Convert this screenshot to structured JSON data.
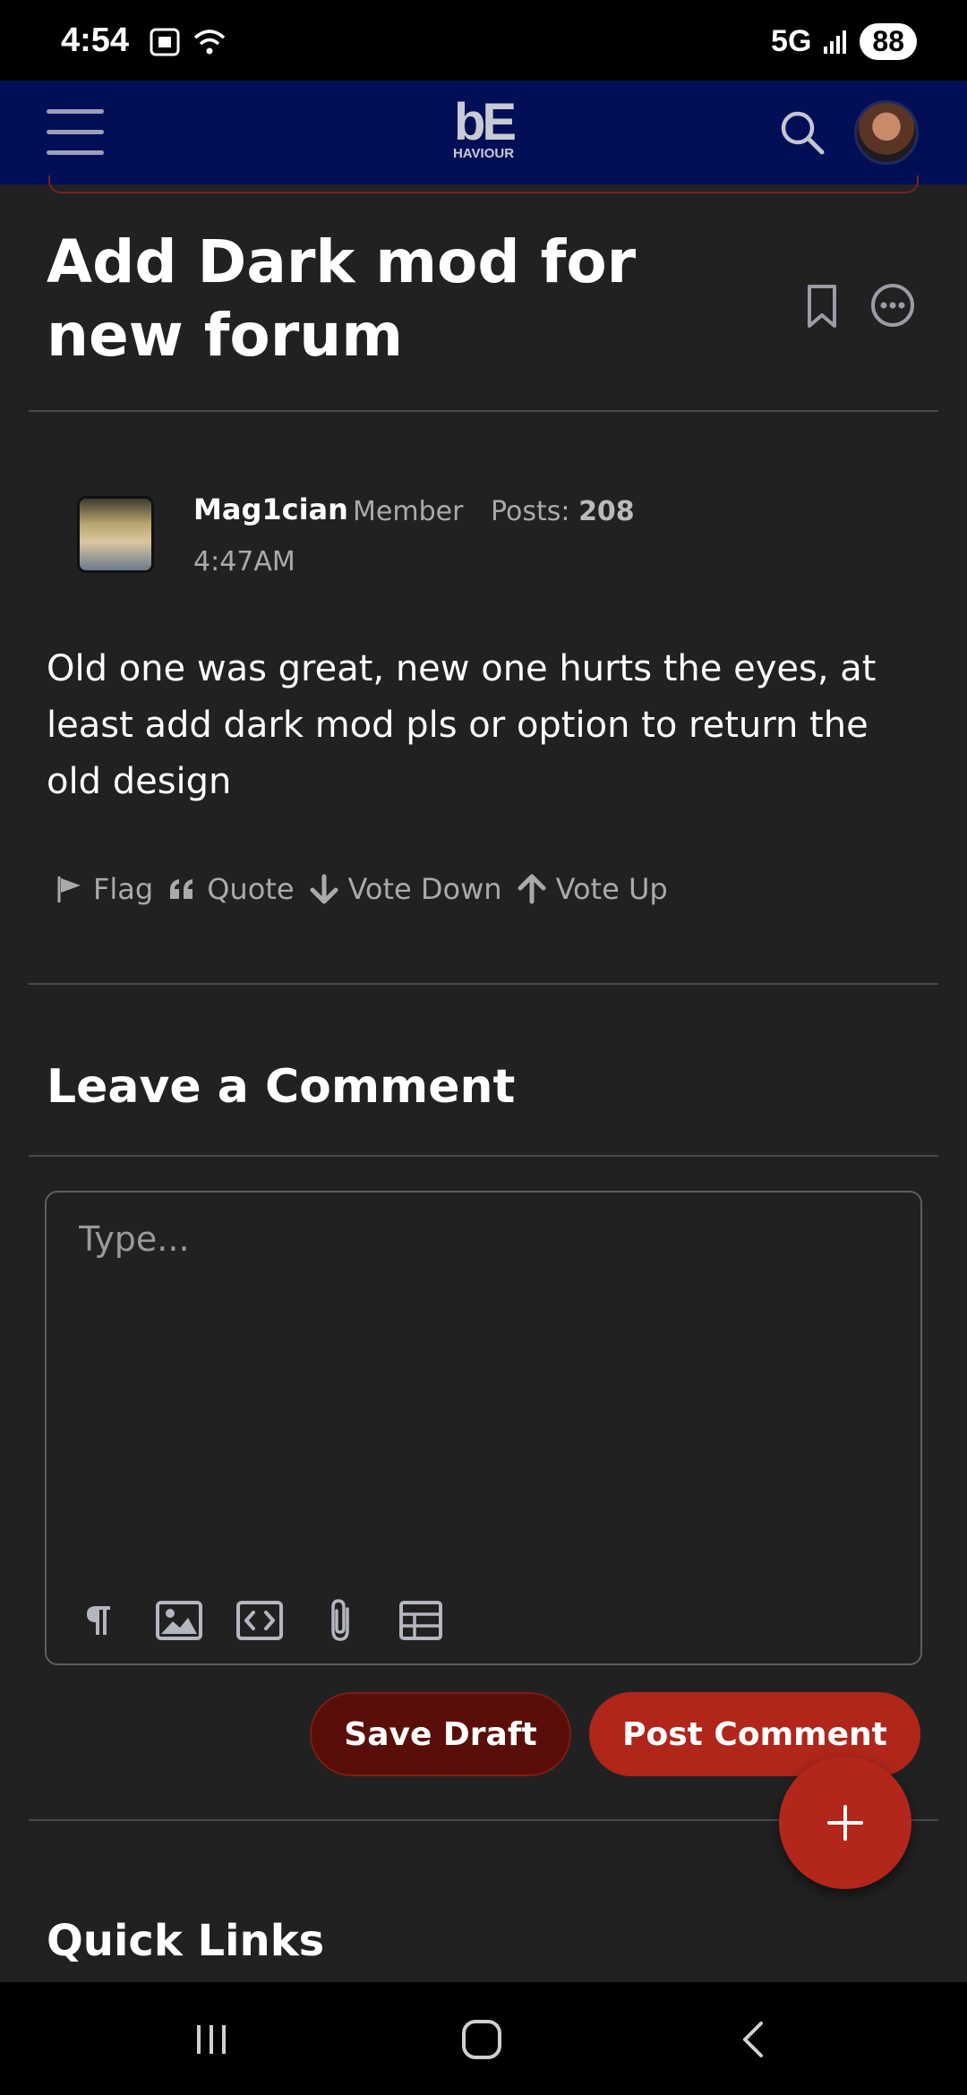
{
  "status_bar": {
    "time": "4:54",
    "network": "5G",
    "battery": "88"
  },
  "header": {
    "logo_main": "bE",
    "logo_sub": "HAVIOUR"
  },
  "post": {
    "title": "Add Dark mod for new forum",
    "author": {
      "name": "Mag1cian",
      "role": "Member",
      "posts_label": "Posts:",
      "posts_count": "208",
      "time": "4:47AM"
    },
    "body": "Old one was great, new one hurts the eyes, at least add dark mod pls or option to return the old design",
    "actions": {
      "flag": "Flag",
      "quote": "Quote",
      "vote_down": "Vote Down",
      "vote_up": "Vote Up"
    }
  },
  "comment": {
    "heading": "Leave a Comment",
    "placeholder": "Type...",
    "save_label": "Save Draft",
    "post_label": "Post Comment"
  },
  "footer": {
    "quick_links": "Quick Links"
  },
  "colors": {
    "header_bg": "#020f57",
    "accent": "#b0261b",
    "page_bg": "#212121"
  }
}
